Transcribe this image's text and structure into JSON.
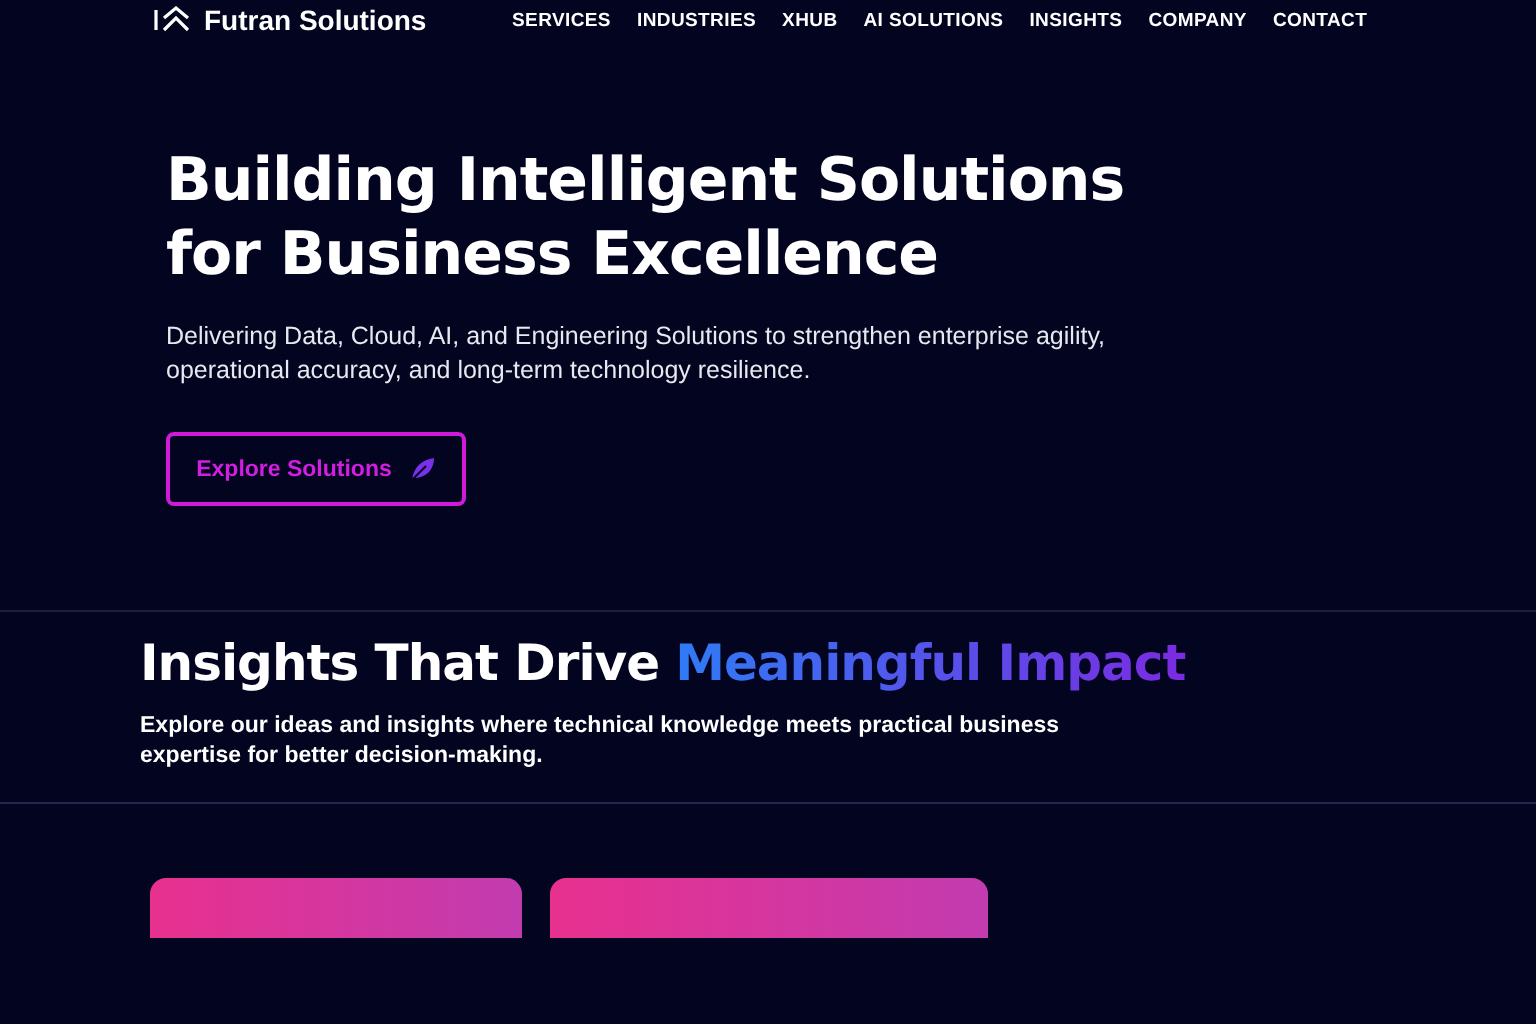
{
  "header": {
    "brand": "Futran Solutions",
    "nav": [
      {
        "label": "SERVICES"
      },
      {
        "label": "INDUSTRIES"
      },
      {
        "label": "XHUB"
      },
      {
        "label": "AI SOLUTIONS"
      },
      {
        "label": "INSIGHTS"
      },
      {
        "label": "COMPANY"
      },
      {
        "label": "CONTACT"
      }
    ]
  },
  "hero": {
    "title_lines": [
      "Building Intelligent Solutions",
      "for Business Excellence"
    ],
    "subtitle": "Delivering Data, Cloud, AI, and Engineering Solutions to strengthen enterprise agility, operational accuracy, and long-term technology resilience.",
    "button": "Explore Solutions"
  },
  "insights": {
    "title": "Insights That Drive",
    "title_highlight": "Meaningful Impact",
    "description": "Explore our ideas and insights where technical knowledge meets practical business expertise for better decision-making.",
    "cards": [
      {
        "kind": "card"
      },
      {
        "kind": "card"
      }
    ]
  }
}
